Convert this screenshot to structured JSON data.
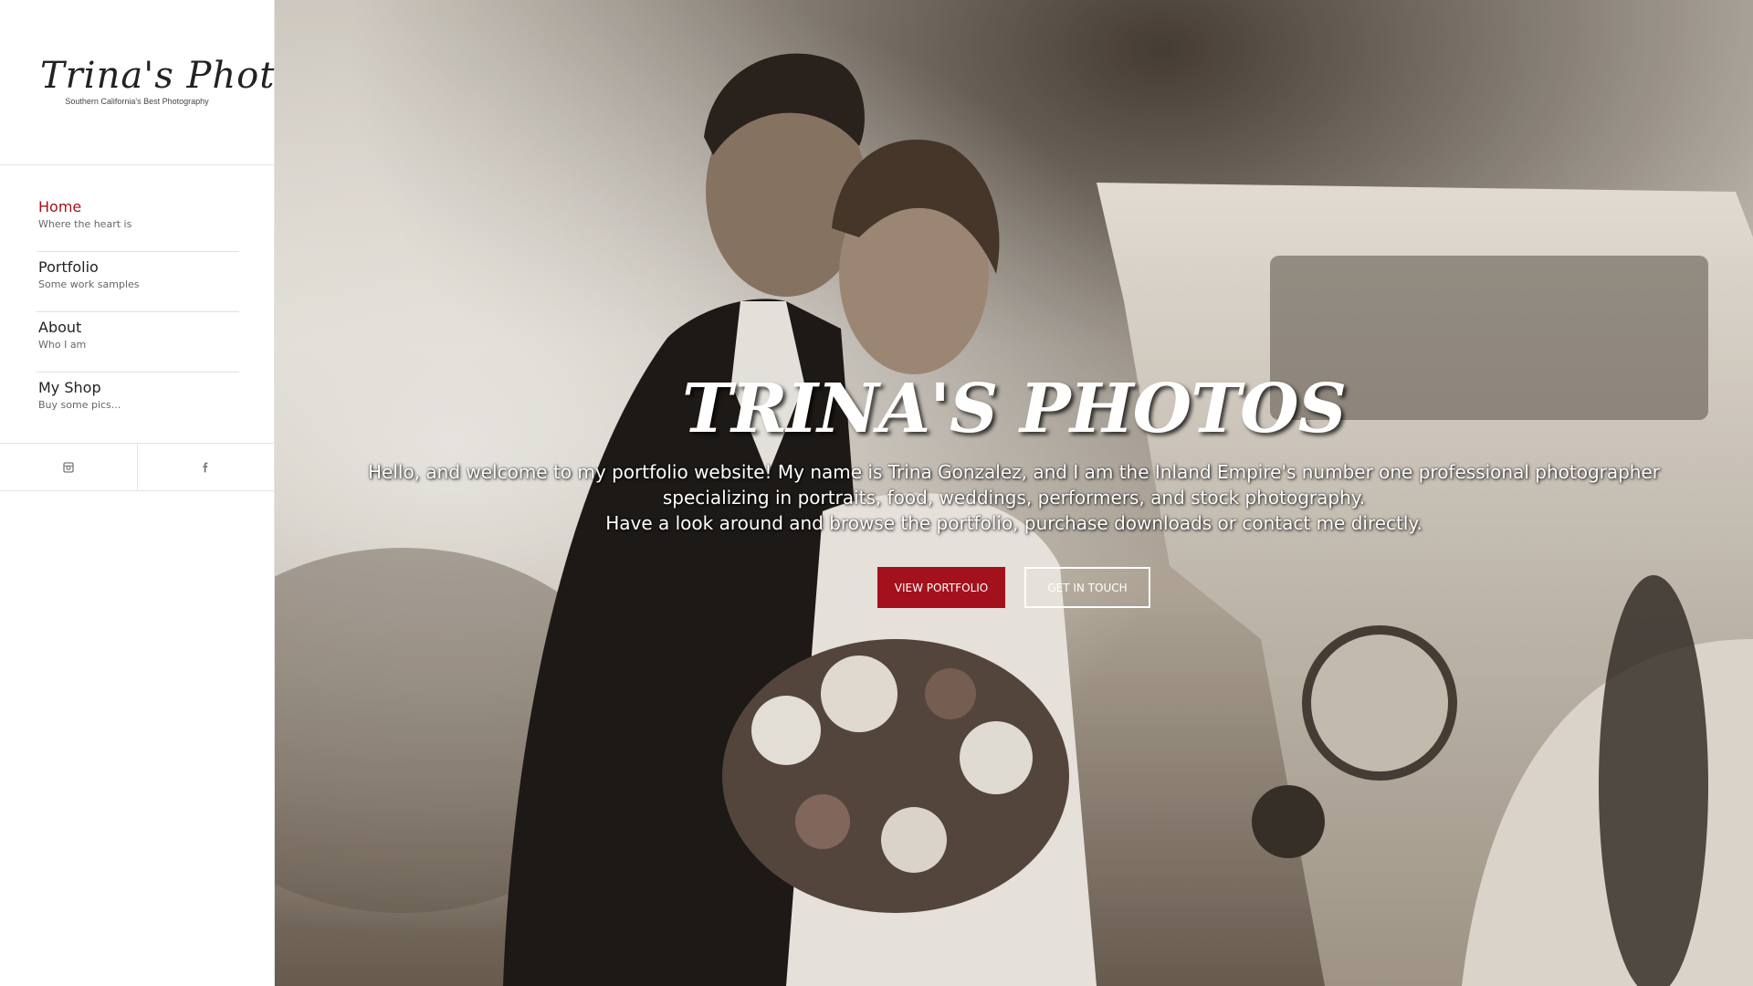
{
  "brand": {
    "logo_text": "Trina's Photos",
    "tagline": "Southern California's Best Photography"
  },
  "menu": [
    {
      "label": "Home",
      "sub": "Where the heart is",
      "active": true
    },
    {
      "label": "Portfolio",
      "sub": "Some work samples",
      "active": false
    },
    {
      "label": "About",
      "sub": "Who I am",
      "active": false
    },
    {
      "label": "My Shop",
      "sub": "Buy some pics...",
      "active": false
    }
  ],
  "social": [
    {
      "icon": "instagram-icon"
    },
    {
      "icon": "facebook-icon"
    }
  ],
  "hero": {
    "title": "TRINA'S PHOTOS",
    "lines": [
      "Hello, and welcome to my portfolio website! My name is Trina Gonzalez, and I am the Inland Empire's number one professional photographer",
      "specializing in portraits, food, weddings, performers, and stock photography.",
      "Have a look around and browse the portfolio, purchase downloads or contact me directly."
    ],
    "primary_button": "VIEW PORTFOLIO",
    "secondary_button": "GET IN TOUCH"
  },
  "colors": {
    "accent": "#a3121c",
    "sidebar_bg": "#ffffff",
    "border": "#e4e4e4"
  }
}
